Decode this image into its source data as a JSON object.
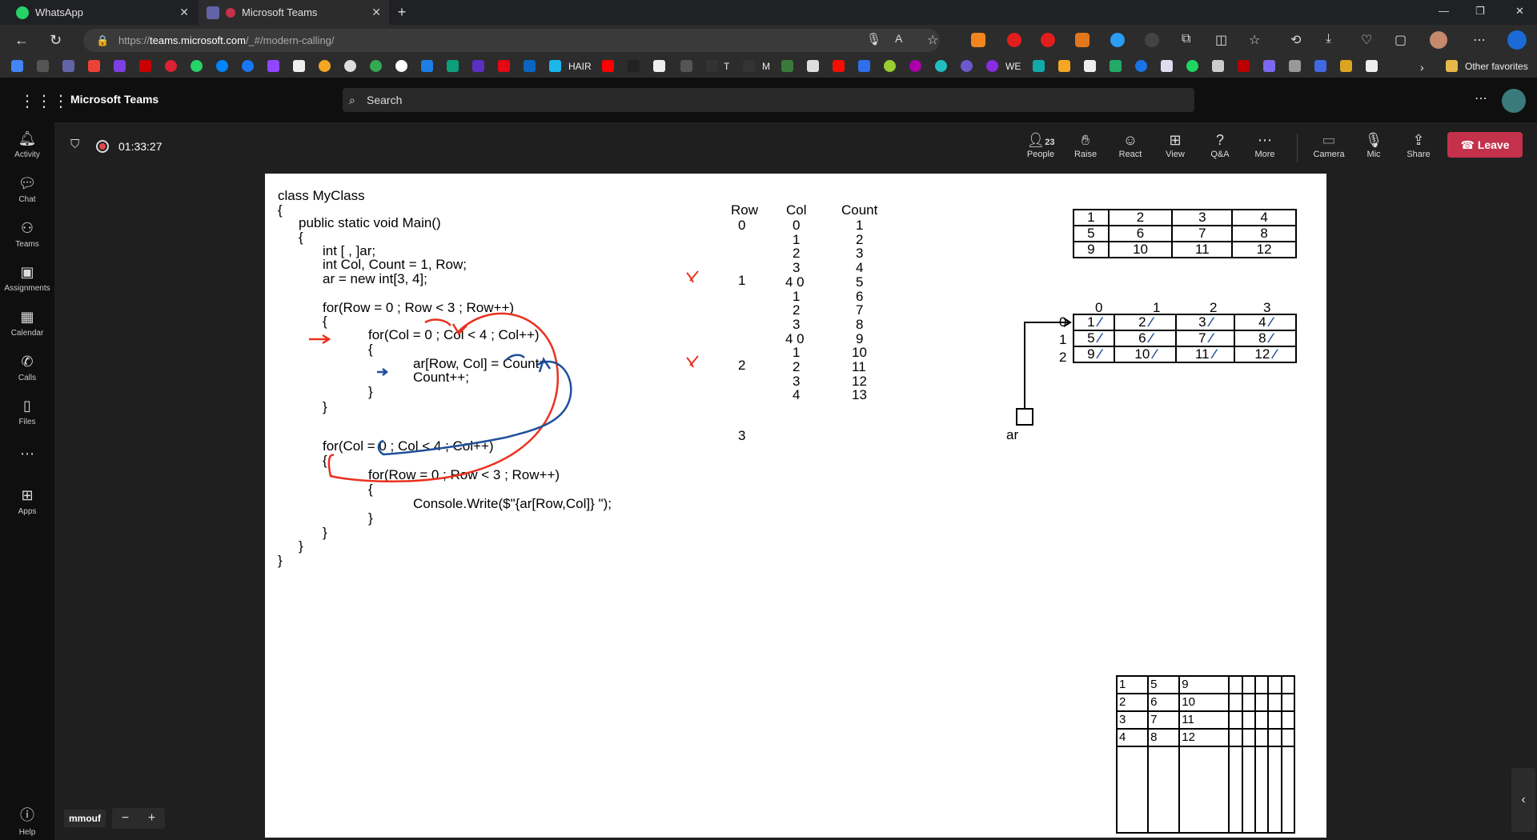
{
  "browser": {
    "tabs": [
      {
        "label": "WhatsApp"
      },
      {
        "label": "Microsoft Teams"
      }
    ],
    "url_prefix": "https://",
    "url_host": "teams.microsoft.com",
    "url_path": "/_#/modern-calling/",
    "favorites": {
      "hair": "HAIR",
      "t": "T",
      "m": "M",
      "we": "WE",
      "other": "Other favorites"
    }
  },
  "teams": {
    "app_title": "Microsoft Teams",
    "search_placeholder": "Search",
    "sidebar": [
      {
        "label": "Activity"
      },
      {
        "label": "Chat"
      },
      {
        "label": "Teams"
      },
      {
        "label": "Assignments"
      },
      {
        "label": "Calendar"
      },
      {
        "label": "Calls"
      },
      {
        "label": "Files"
      },
      {
        "label": "Apps"
      },
      {
        "label": "Help"
      }
    ],
    "meeting": {
      "timer": "01:33:27",
      "people_count": "23",
      "controls": [
        {
          "label": "People"
        },
        {
          "label": "Raise"
        },
        {
          "label": "React"
        },
        {
          "label": "View"
        },
        {
          "label": "Q&A"
        },
        {
          "label": "More"
        },
        {
          "label": "Camera"
        },
        {
          "label": "Mic"
        },
        {
          "label": "Share"
        }
      ],
      "leave_label": "Leave"
    },
    "presenter_name": "mmouf"
  },
  "whiteboard": {
    "code_lines": [
      "class MyClass",
      "{",
      "public static void Main()",
      "{",
      "int [ , ]ar;",
      "int Col, Count = 1, Row;",
      "ar = new int[3, 4];",
      "for(Row = 0 ; Row < 3 ; Row++)",
      "{",
      "for(Col = 0 ; Col < 4 ; Col++)",
      "{",
      "ar[Row, Col] = Count;",
      "Count++;",
      "}",
      "}",
      "for(Col = 0 ; Col < 4 ; Col++)",
      "{",
      "for(Row = 0 ; Row < 3 ; Row++)",
      "{",
      "Console.Write($\"{ar[Row,Col]} \");",
      "}",
      "}",
      "}",
      "}"
    ],
    "trace": {
      "headers": [
        "Row",
        "Col",
        "Count"
      ],
      "row_values": [
        "0",
        "1",
        "2",
        "3"
      ],
      "col_values": [
        "0",
        "1",
        "2",
        "3",
        "4 0",
        "1",
        "2",
        "3",
        "4 0",
        "1",
        "2",
        "3",
        "4"
      ],
      "count_values": [
        "1",
        "2",
        "3",
        "4",
        "5",
        "6",
        "7",
        "8",
        "9",
        "10",
        "11",
        "12",
        "13"
      ]
    },
    "grid1": [
      [
        "1",
        "2",
        "3",
        "4"
      ],
      [
        "5",
        "6",
        "7",
        "8"
      ],
      [
        "9",
        "10",
        "11",
        "12"
      ]
    ],
    "grid2_col_idx": [
      "0",
      "1",
      "2",
      "3"
    ],
    "grid2_row_idx": [
      "0",
      "1",
      "2"
    ],
    "grid2": [
      [
        "1",
        "2",
        "3",
        "4"
      ],
      [
        "5",
        "6",
        "7",
        "8"
      ],
      [
        "9",
        "10",
        "11",
        "12"
      ]
    ],
    "array_label": "ar",
    "grid3": [
      [
        "1",
        "5",
        "9"
      ],
      [
        "2",
        "6",
        "10"
      ],
      [
        "3",
        "7",
        "11"
      ],
      [
        "4",
        "8",
        "12"
      ]
    ]
  }
}
